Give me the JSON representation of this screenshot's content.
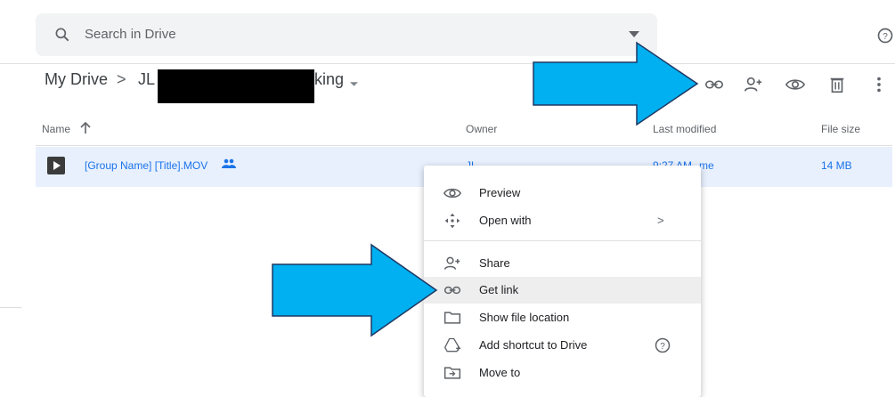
{
  "search": {
    "placeholder": "Search in Drive"
  },
  "breadcrumb": {
    "root": "My Drive",
    "separator": ">",
    "folder_prefix": "JL",
    "folder_suffix": "king"
  },
  "columns": {
    "name": "Name",
    "owner": "Owner",
    "last_modified": "Last modified",
    "file_size": "File size"
  },
  "file": {
    "name": "[Group Name] [Title].MOV",
    "owner": "JL",
    "modified": "9:27 AM",
    "modified_by": "me",
    "size": "14 MB"
  },
  "toolbar": {
    "icons": [
      "link-icon",
      "add-person-icon",
      "eye-icon",
      "trash-icon",
      "more-vert-icon"
    ]
  },
  "context_menu": {
    "items": [
      {
        "label": "Preview",
        "icon": "eye-icon"
      },
      {
        "label": "Open with",
        "icon": "move-arrows-icon",
        "submenu_glyph": ">"
      },
      {
        "label": "Share",
        "icon": "add-person-icon"
      },
      {
        "label": "Get link",
        "icon": "link-icon",
        "highlighted": true
      },
      {
        "label": "Show file location",
        "icon": "folder-icon"
      },
      {
        "label": "Add shortcut to Drive",
        "icon": "drive-shortcut-icon"
      },
      {
        "label": "Move to",
        "icon": "move-to-icon"
      }
    ]
  },
  "colors": {
    "accent": "#1a73e8",
    "row_selected": "#e8f0fe",
    "annotation_arrow": "#00b0f0"
  }
}
